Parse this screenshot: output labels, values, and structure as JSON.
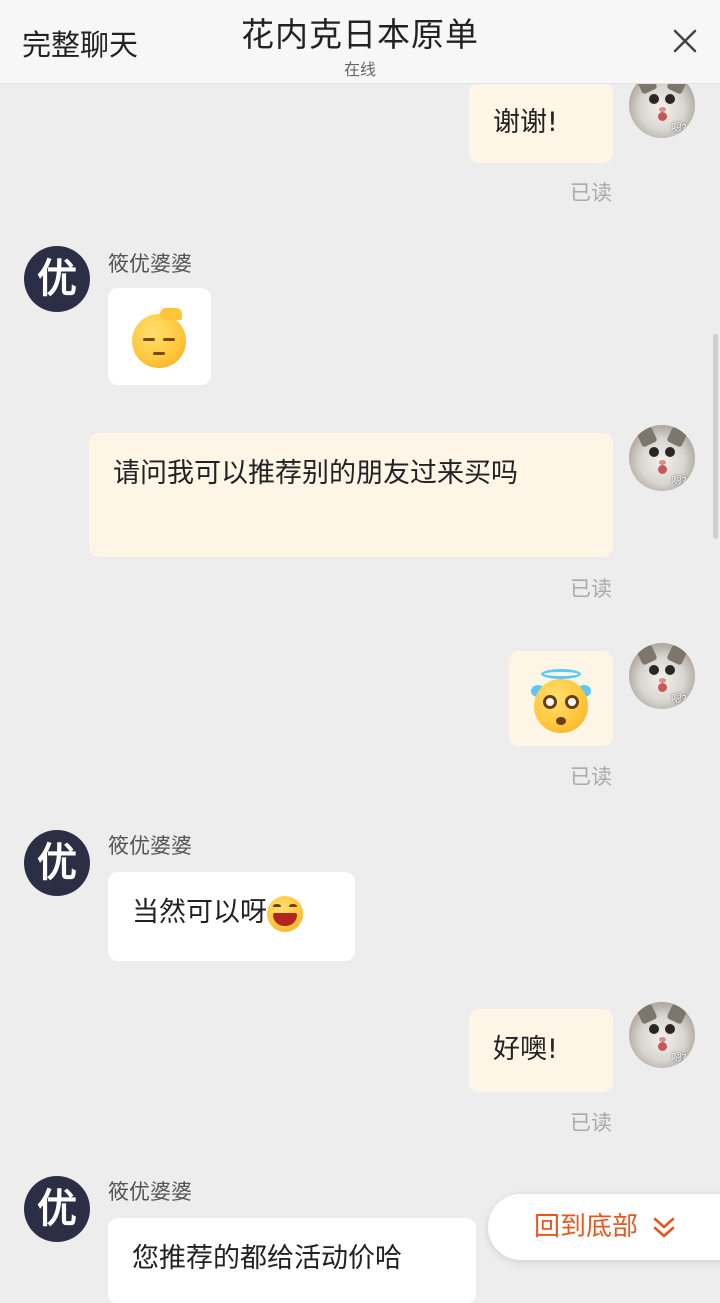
{
  "header": {
    "left_label": "完整聊天",
    "title": "花内克日本原单",
    "status": "在线",
    "close_icon": "close-icon"
  },
  "avatars": {
    "self_tag": "嗯?",
    "other_initial": "优"
  },
  "messages": [
    {
      "direction": "out",
      "text": "谢谢!",
      "read": "已读"
    },
    {
      "direction": "in",
      "sender": "筱优婆婆",
      "emoji": "sleepy-face-emoji"
    },
    {
      "direction": "out",
      "text": "请问我可以推荐别的朋友过来买吗",
      "read": "已读"
    },
    {
      "direction": "out",
      "emoji": "starry-eyed-angel-emoji",
      "read": "已读"
    },
    {
      "direction": "in",
      "sender": "筱优婆婆",
      "text": "当然可以呀",
      "emoji": "laughing-face-emoji"
    },
    {
      "direction": "out",
      "text": "好噢!",
      "read": "已读"
    },
    {
      "direction": "in",
      "sender": "筱优婆婆",
      "text": "您推荐的都给活动价哈"
    }
  ],
  "back_to_bottom": {
    "label": "回到底部",
    "icon": "double-chevron-down-icon"
  },
  "colors": {
    "background": "#ededed",
    "out_bubble": "#fdf5e6",
    "in_bubble": "#ffffff",
    "accent": "#e8571d"
  }
}
